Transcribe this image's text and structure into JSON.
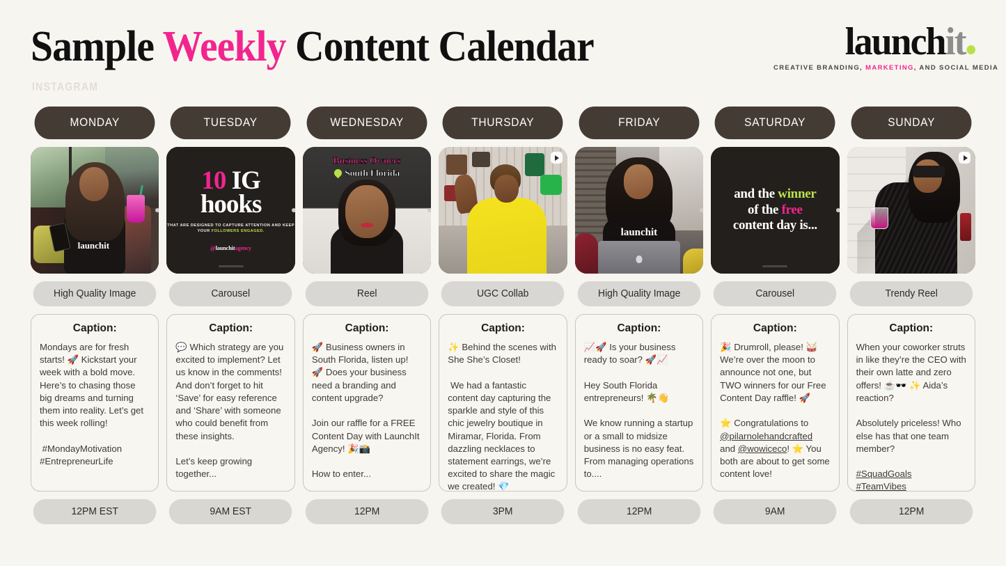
{
  "header": {
    "title_part1": "Sample ",
    "title_highlight": "Weekly",
    "title_part2": " Content Calendar",
    "subtitle": "INSTAGRAM",
    "logo": {
      "word_black": "launch",
      "word_gray": "it",
      "tagline_pre": "CREATIVE BRANDING, ",
      "tagline_highlight": "MARKETING",
      "tagline_post": ", AND SOCIAL MEDIA",
      "accent_dot_color": "#b9e04a",
      "pink": "#f2258e"
    }
  },
  "colors": {
    "background": "#f7f5f0",
    "day_pill": "#443c34",
    "type_pill": "#d8d7d3",
    "pink": "#f2258e",
    "lime": "#b9e04a"
  },
  "caption_label": "Caption:",
  "days": [
    {
      "day": "MONDAY",
      "content_type": "High Quality Image",
      "time": "12PM EST",
      "thumb_alt": "woman-with-braids-launchit-tee-phone-pink-drink",
      "thumb_overlay": {
        "tee_text": "launchit"
      },
      "caption": "Mondays are for fresh starts! 🚀 Kickstart your week with a bold move. Here’s to chasing those big dreams and turning them into reality. Let’s get this week rolling!\n\n #MondayMotivation #EntrepreneurLife"
    },
    {
      "day": "TUESDAY",
      "content_type": "Carousel",
      "time": "9AM EST",
      "thumb_alt": "dark-graphic-10-ig-hooks",
      "thumb_overlay": {
        "num": "10",
        "line1_rest": " IG",
        "line2": "hooks",
        "sub_pre": "THAT ARE DESIGNED TO CAPTURE ATTENTION AND KEEP YOUR ",
        "sub_highlight": "FOLLOWERS ENGAGED.",
        "handle_at": "@",
        "handle_name": "launchit",
        "handle_suffix": "agency"
      },
      "caption": "💬 Which strategy are you excited to implement? Let us know in the comments! And don’t forget to hit ‘Save’ for easy reference and ‘Share’ with someone who could benefit from these insights.\n\nLet’s keep growing together..."
    },
    {
      "day": "WEDNESDAY",
      "content_type": "Reel",
      "time": "12PM",
      "thumb_alt": "woman-talking-to-camera-reel",
      "thumb_overlay": {
        "line1": "Business Owners",
        "line2": "South Florida"
      },
      "caption": "🚀 Business owners in South Florida, listen up! 🚀 Does your business need a branding and content upgrade?\n\nJoin our raffle for a FREE Content Day with LaunchIt Agency! 🎉📸\n\nHow to enter..."
    },
    {
      "day": "THURSDAY",
      "content_type": "UGC Collab",
      "time": "3PM",
      "thumb_alt": "woman-in-yellow-top-waving-in-handbag-boutique",
      "has_reel_badge": true,
      "caption": "✨ Behind the scenes with She She’s Closet!\n\n We had a fantastic content day capturing the sparkle and style of this chic jewelry boutique in Miramar, Florida. From dazzling necklaces to statement earrings, we’re excited to share the magic we created! 💎"
    },
    {
      "day": "FRIDAY",
      "content_type": "High Quality Image",
      "time": "12PM",
      "thumb_alt": "woman-with-laptop-in-launchit-tee",
      "thumb_overlay": {
        "tee_text": "launchit"
      },
      "caption": "📈🚀 Is your business ready to soar? 🚀📈\n\nHey South Florida entrepreneurs! 🌴👋\n\nWe know running a startup or a small to midsize business is no easy feat. From managing operations to...."
    },
    {
      "day": "SATURDAY",
      "content_type": "Carousel",
      "time": "9AM",
      "thumb_alt": "dark-graphic-winner-announcement",
      "thumb_overlay": {
        "l1_pre": "and the ",
        "l1_highlight": "winner",
        "l2_pre": "of the ",
        "l2_highlight": "free",
        "l3": "content day is..."
      },
      "caption_html": "🎉 Drumroll, please! 🥁 We’re over the moon to announce not one, but TWO winners for our Free Content Day raffle! 🚀\n\n⭐ Congratulations to <u>@pilarnolehandcrafted</u> and <u>@wowiceco</u>! ⭐ You both are about to get some content love!"
    },
    {
      "day": "SUNDAY",
      "content_type": "Trendy Reel",
      "time": "12PM",
      "thumb_alt": "woman-in-sunglasses-and-fur-coat-with-pink-drink",
      "has_reel_badge": true,
      "caption_html": "When your coworker struts in like they’re the CEO with their own latte and zero offers! ☕🕶️ ✨ Aida’s reaction?\n\nAbsolutely priceless! Who else has that one team member?\n\n<u>#SquadGoals</u>\n<u>#TeamVibes</u>"
    }
  ]
}
